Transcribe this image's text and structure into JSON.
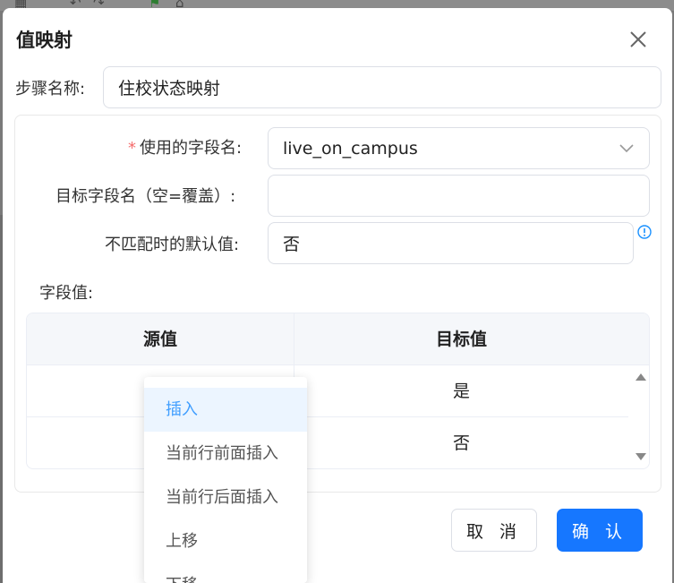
{
  "dialog": {
    "title": "值映射",
    "step_name_label": "步骤名称:",
    "step_name_value": "住校状态映射"
  },
  "form": {
    "field_name_required": "*",
    "field_name_label": "使用的字段名:",
    "field_name_value": "live_on_campus",
    "target_field_label": "目标字段名（空=覆盖）:",
    "target_field_value": "",
    "default_value_label": "不匹配时的默认值:",
    "default_value_value": "否",
    "field_values_label": "字段值:"
  },
  "table": {
    "columns": [
      "源值",
      "目标值"
    ],
    "rows": [
      {
        "source": "",
        "target": "是"
      },
      {
        "source": "",
        "target": "否"
      }
    ]
  },
  "context_menu": {
    "items": [
      "插入",
      "当前行前面插入",
      "当前行后面插入",
      "上移",
      "下移"
    ],
    "active_index": 0
  },
  "buttons": {
    "cancel": "取 消",
    "confirm": "确 认"
  },
  "colors": {
    "primary": "#1677ff",
    "required": "#f56c6c",
    "menu_active_bg": "#ecf5ff",
    "menu_active_text": "#409eff",
    "info": "#1890ff"
  }
}
